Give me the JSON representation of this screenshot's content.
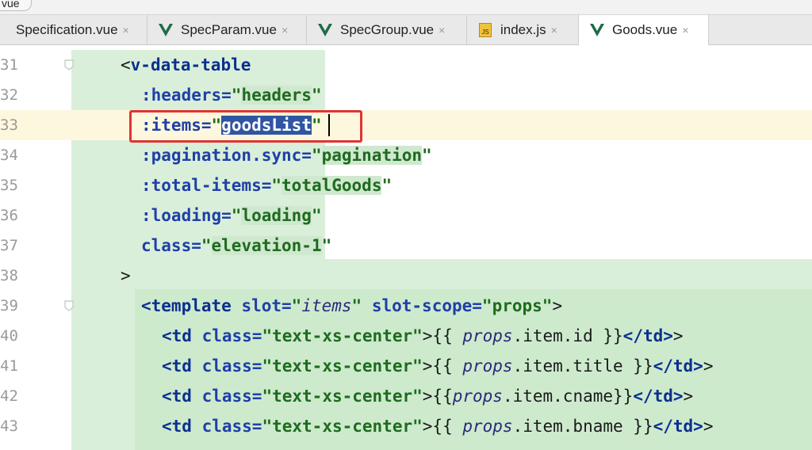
{
  "breadcrumb": {
    "label": "vue"
  },
  "tabs": [
    {
      "label": "Specification.vue",
      "icon": "vue-icon",
      "active": false
    },
    {
      "label": "SpecParam.vue",
      "icon": "vue-icon",
      "active": false
    },
    {
      "label": "SpecGroup.vue",
      "icon": "vue-icon",
      "active": false
    },
    {
      "label": "index.js",
      "icon": "js-file-icon",
      "active": false
    },
    {
      "label": "Goods.vue",
      "icon": "vue-icon",
      "active": true
    }
  ],
  "tab_close_glyph": "×",
  "js_icon_text": "JS",
  "line_numbers": [
    "31",
    "32",
    "33",
    "34",
    "35",
    "36",
    "37",
    "38",
    "39",
    "40",
    "41",
    "42",
    "43"
  ],
  "code": {
    "l31": {
      "open": "<",
      "tag": "v-data-table"
    },
    "l32": {
      "attr": ":headers=",
      "value": "headers"
    },
    "l33": {
      "attr": ":items=",
      "value": "goodsList"
    },
    "l34": {
      "attr": ":pagination.sync=",
      "value": "pagination"
    },
    "l35": {
      "attr": ":total-items=",
      "value": "totalGoods"
    },
    "l36": {
      "attr": ":loading=",
      "value": "loading"
    },
    "l37": {
      "attr": "class=",
      "value": "elevation-1"
    },
    "l38": {
      "close": ">"
    },
    "l39": {
      "tag": "<template",
      "attr1": " slot=",
      "val1": "items",
      "attr2": " slot-scope=",
      "val2": "props",
      "end": ">"
    },
    "l40": {
      "tag": "<td",
      "attr": " class=",
      "value": "text-xs-center",
      "expr_open": ">{{ ",
      "obj": "props",
      "path": ".item.id",
      "expr_close": " }}",
      "end_tag": "</td>",
      "end": ">"
    },
    "l41": {
      "tag": "<td",
      "attr": " class=",
      "value": "text-xs-center",
      "expr_open": ">{{ ",
      "obj": "props",
      "path": ".item.title",
      "expr_close": " }}",
      "end_tag": "</td>",
      "end": ">"
    },
    "l42": {
      "tag": "<td",
      "attr": " class=",
      "value": "text-xs-center",
      "expr_open": ">{{",
      "obj": "props",
      "path": ".item.cname",
      "expr_close": "}}",
      "end_tag": "</td>",
      "end": ">"
    },
    "l43": {
      "tag": "<td",
      "attr": " class=",
      "value": "text-xs-center",
      "expr_open": ">{{ ",
      "obj": "props",
      "path": ".item.bname",
      "expr_close": " }}",
      "end_tag": "</td>",
      "end": ">"
    }
  },
  "quote": "\"",
  "colors": {
    "selection": "#2f56a3",
    "highlight_box": "#e23232",
    "block_shade": "#d9efd9"
  }
}
